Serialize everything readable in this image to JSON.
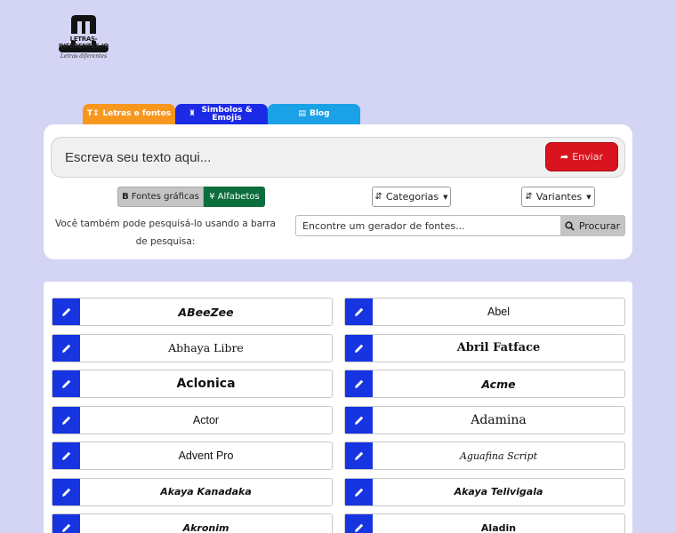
{
  "logo": {
    "text": "LETRAS-DIFERENTES.IO",
    "sub": "Letras diferentes"
  },
  "tabs": [
    {
      "label": "Letras e fontes",
      "icon": "font-size-icon"
    },
    {
      "label": "Simbolos & Emojis",
      "icon": "chess-icon"
    },
    {
      "label": "Blog",
      "icon": "newspaper-icon"
    }
  ],
  "input": {
    "placeholder": "Escreva seu texto aqui..."
  },
  "send_label": "Enviar",
  "toggle": {
    "graficas": "Fontes gráficas",
    "alfabetos": "Alfabetos"
  },
  "dropdowns": {
    "categorias": "Categorias",
    "variantes": "Variantes"
  },
  "hint": "Você também pode pesquisá-lo usando a barra de pesquisa:",
  "search": {
    "placeholder": "Encontre um gerador de fontes...",
    "button": "Procurar"
  },
  "fonts": [
    "ABeeZee",
    "Abel",
    "Abhaya Libre",
    "Abril Fatface",
    "Aclonica",
    "Acme",
    "Actor",
    "Adamina",
    "Advent Pro",
    "Aguafina Script",
    "Akaya Kanadaka",
    "Akaya Telivigala",
    "Akronim",
    "Aladin"
  ],
  "colors": {
    "background": "#d4d4f4",
    "edit_button": "#1635e0",
    "send_button": "#d9141e",
    "tab_letras": "#f7971e",
    "tab_simbolos": "#1c2ae6",
    "tab_blog": "#1ba1e6"
  }
}
